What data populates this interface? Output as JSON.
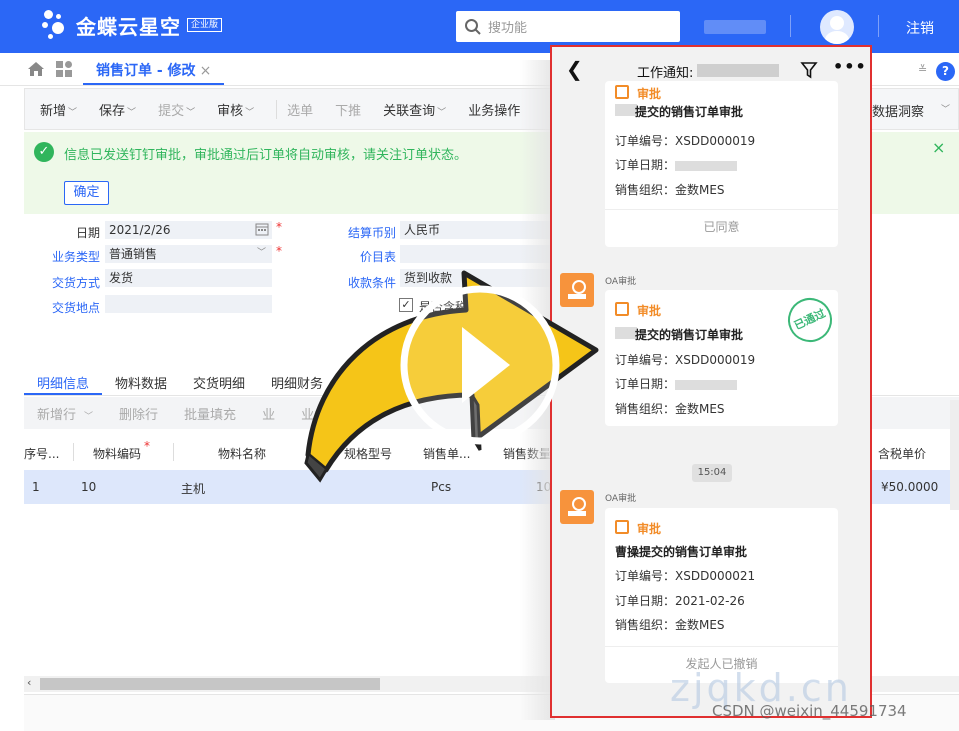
{
  "header": {
    "logo_text": "金蝶云星空",
    "logo_badge": "企业版",
    "search_placeholder": "搜功能",
    "logout": "注销"
  },
  "tabs": {
    "active_label": "销售订单 - 修改",
    "close": "×",
    "collapse": "≚",
    "help": "?"
  },
  "toolbar": {
    "items": [
      {
        "label": "新增",
        "dropdown": true,
        "disabled": false
      },
      {
        "label": "保存",
        "dropdown": true,
        "disabled": false
      },
      {
        "label": "提交",
        "dropdown": true,
        "disabled": true
      },
      {
        "label": "审核",
        "dropdown": true,
        "disabled": false
      },
      {
        "label": "选单",
        "dropdown": false,
        "disabled": true
      },
      {
        "label": "下推",
        "dropdown": false,
        "disabled": true
      },
      {
        "label": "关联查询",
        "dropdown": true,
        "disabled": false
      },
      {
        "label": "业务操作",
        "dropdown": false,
        "disabled": false
      }
    ],
    "right_label": "数据洞察"
  },
  "notice": {
    "text": "信息已发送钉钉审批，审批通过后订单将自动审核，请关注订单状态。",
    "confirm": "确定",
    "close": "×"
  },
  "form": {
    "date_label": "日期",
    "date_value": "2021/2/26",
    "biz_type_label": "业务类型",
    "biz_type_value": "普通销售",
    "delivery_mode_label": "交货方式",
    "delivery_mode_value": "发货",
    "delivery_place_label": "交货地点",
    "delivery_place_value": "",
    "currency_label": "结算币别",
    "currency_value": "人民币",
    "price_list_label": "价目表",
    "price_list_value": "",
    "payment_label": "收款条件",
    "payment_value": "货到收款",
    "checkbox_label": "是否含税"
  },
  "subtabs": [
    "明细信息",
    "物料数据",
    "交货明细",
    "明细财务"
  ],
  "gridbar": [
    "新增行",
    "删除行",
    "批量填充",
    "业",
    "业务查询"
  ],
  "grid": {
    "headers": [
      "序号...",
      "物料编码",
      "物料名称",
      "规格型号",
      "销售单...",
      "销售数量",
      "含税单价"
    ],
    "row": {
      "seq": "1",
      "code": "10",
      "name": "主机",
      "unit": "Pcs",
      "qty": "10",
      "price": "¥50.0000"
    }
  },
  "phone": {
    "title": "工作通知:",
    "card1": {
      "tag": "审批",
      "title": "提交的销售订单审批",
      "order_no": "订单编号：XSDD000019",
      "order_date": "订单日期：",
      "org": "销售组织：金数MES",
      "footer": "已同意"
    },
    "oa_label": "OA审批",
    "card2": {
      "tag": "审批",
      "title": "提交的销售订单审批",
      "order_no": "订单编号：XSDD000019",
      "order_date": "订单日期：",
      "org": "销售组织：金数MES",
      "stamp": "已通过"
    },
    "time": "15:04",
    "card3": {
      "tag": "审批",
      "title": "曹操提交的销售订单审批",
      "order_no": "订单编号：XSDD000021",
      "order_date": "订单日期：2021-02-26",
      "org": "销售组织：金数MES",
      "footer": "发起人已撤销"
    }
  },
  "watermark": {
    "site": "zjqkd.cn",
    "csdn": "CSDN @weixin_44591734"
  }
}
